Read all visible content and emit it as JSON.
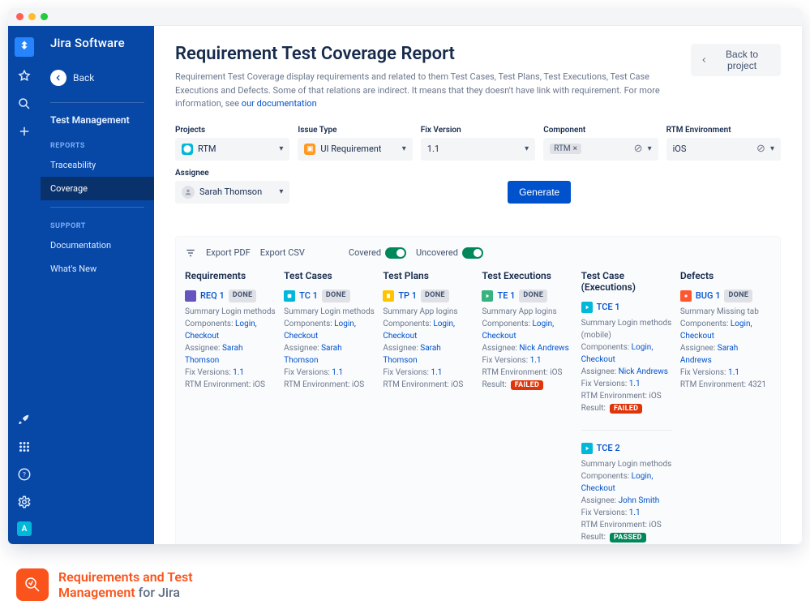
{
  "brand": "Jira Software",
  "back_label": "Back",
  "sidebar": {
    "title": "Test Management",
    "sections": [
      {
        "label": "REPORTS",
        "items": [
          {
            "label": "Traceability",
            "active": false
          },
          {
            "label": "Coverage",
            "active": true
          }
        ]
      },
      {
        "label": "SUPPORT",
        "items": [
          {
            "label": "Documentation"
          },
          {
            "label": "What's New"
          }
        ]
      }
    ]
  },
  "header": {
    "title": "Requirement Test Coverage Report",
    "back_button": "Back to project",
    "description_a": "Requirement Test Coverage display requirements and related to them Test  Cases, Test Plans, Test Executions, Test Case Executions and Defects. Some of that relations are indirect. It means that they doesn't have link with requirement. For more information, see ",
    "doc_link": "our documentation"
  },
  "filters": {
    "projects": {
      "label": "Projects",
      "value": "RTM"
    },
    "issue_type": {
      "label": "Issue Type",
      "value": "UI Requirement"
    },
    "fix_version": {
      "label": "Fix Version",
      "value": "1.1"
    },
    "component": {
      "label": "Component",
      "chip": "RTM"
    },
    "environment": {
      "label": "RTM Environment",
      "value": "iOS"
    },
    "assignee": {
      "label": "Assignee",
      "value": "Sarah Thomson"
    },
    "generate": "Generate"
  },
  "toolbar": {
    "export_pdf": "Export PDF",
    "export_csv": "Export CSV",
    "covered": "Covered",
    "uncovered": "Uncovered"
  },
  "columns": {
    "requirements": "Requirements",
    "test_cases": "Test Cases",
    "test_plans": "Test Plans",
    "test_executions": "Test Executions",
    "test_case_executions": "Test Case (Executions)",
    "defects": "Defects"
  },
  "labels": {
    "summary": "Summary",
    "components": "Components:",
    "assignee": "Assignee:",
    "fix_versions": "Fix Versions:",
    "rtm_env": "RTM Environment:",
    "result": "Result:",
    "done": "DONE",
    "failed": "FAILED",
    "passed": "PASSED"
  },
  "cards": {
    "req1": {
      "key": "REQ 1",
      "color": "#6554C0",
      "summary": "Login methods",
      "components": "Login, Checkout",
      "assignee": "Sarah Thomson",
      "fix": "1.1",
      "env": "iOS"
    },
    "tc1": {
      "key": "TC 1",
      "color": "#00B8D9",
      "summary": "Login methods",
      "components": "Login, Checkout",
      "assignee": "Sarah Thomson",
      "fix": "1.1",
      "env": "iOS"
    },
    "tp1": {
      "key": "TP 1",
      "color": "#FFC400",
      "summary": "App logins",
      "components": "Login, Checkout",
      "assignee": "Sarah Thomson",
      "fix": "1.1",
      "env": "iOS"
    },
    "te1": {
      "key": "TE 1",
      "color": "#36B37E",
      "summary": "App logins",
      "components": "Login, Checkout",
      "assignee": "Nick Andrews",
      "fix": "1.1",
      "env": "iOS",
      "result": "FAILED"
    },
    "tce1": {
      "key": "TCE 1",
      "color": "#00B8D9",
      "summary": "Login methods (mobile)",
      "components": "Login, Checkout",
      "assignee": "Nick Andrews",
      "fix": "1.1",
      "env": "iOS",
      "result": "FAILED"
    },
    "tce2": {
      "key": "TCE 2",
      "color": "#00B8D9",
      "summary": "Login methods",
      "components": "Login, Checkout",
      "assignee": "John Smith",
      "fix": "1.1",
      "env": "iOS",
      "result": "PASSED"
    },
    "bug1": {
      "key": "BUG 1",
      "color": "#FF5630",
      "summary": "Missing tab",
      "components": "Login, Checkout",
      "assignee": "Sarah Andrews",
      "fix": "1.1",
      "env": "4321"
    }
  },
  "footer": {
    "line1": "Requirements and Test",
    "line2a": "Management",
    "line2b": " for Jira"
  },
  "rail_avatar": "A"
}
